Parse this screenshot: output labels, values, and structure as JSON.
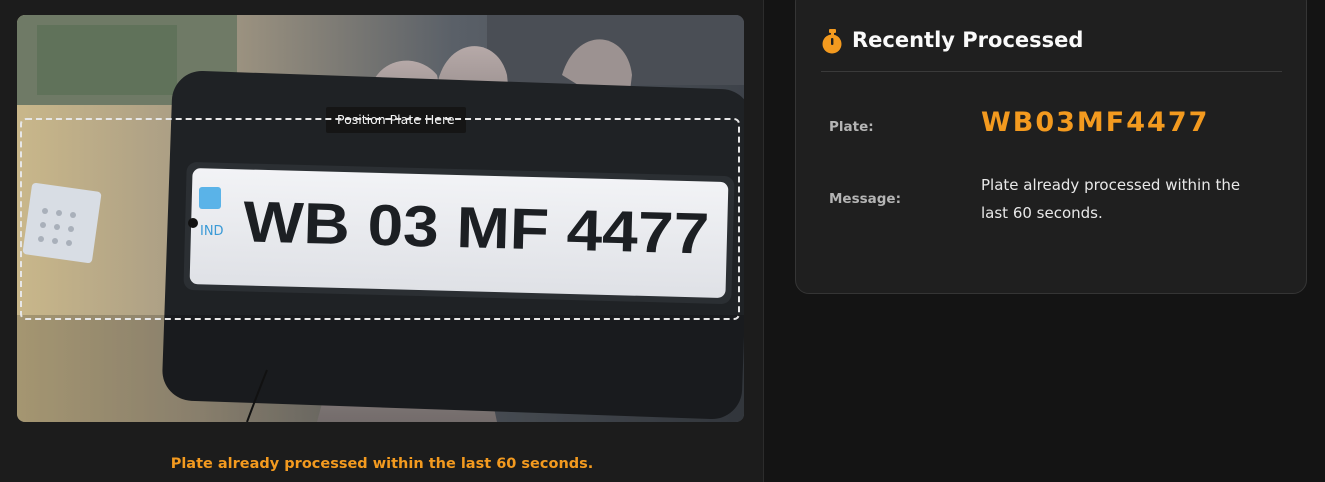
{
  "camera": {
    "guide_label": "Position Plate Here",
    "plate_state": "IND",
    "plate_text": "WB 03 MF 4477"
  },
  "status": {
    "message": "Plate already processed within the last 60 seconds.",
    "color": "#f39a1f"
  },
  "recent": {
    "icon": "stopwatch-icon",
    "title": "Recently Processed",
    "plate_label": "Plate:",
    "plate_value": "WB03MF4477",
    "message_label": "Message:",
    "message_value": "Plate already processed within the last 60 seconds."
  }
}
